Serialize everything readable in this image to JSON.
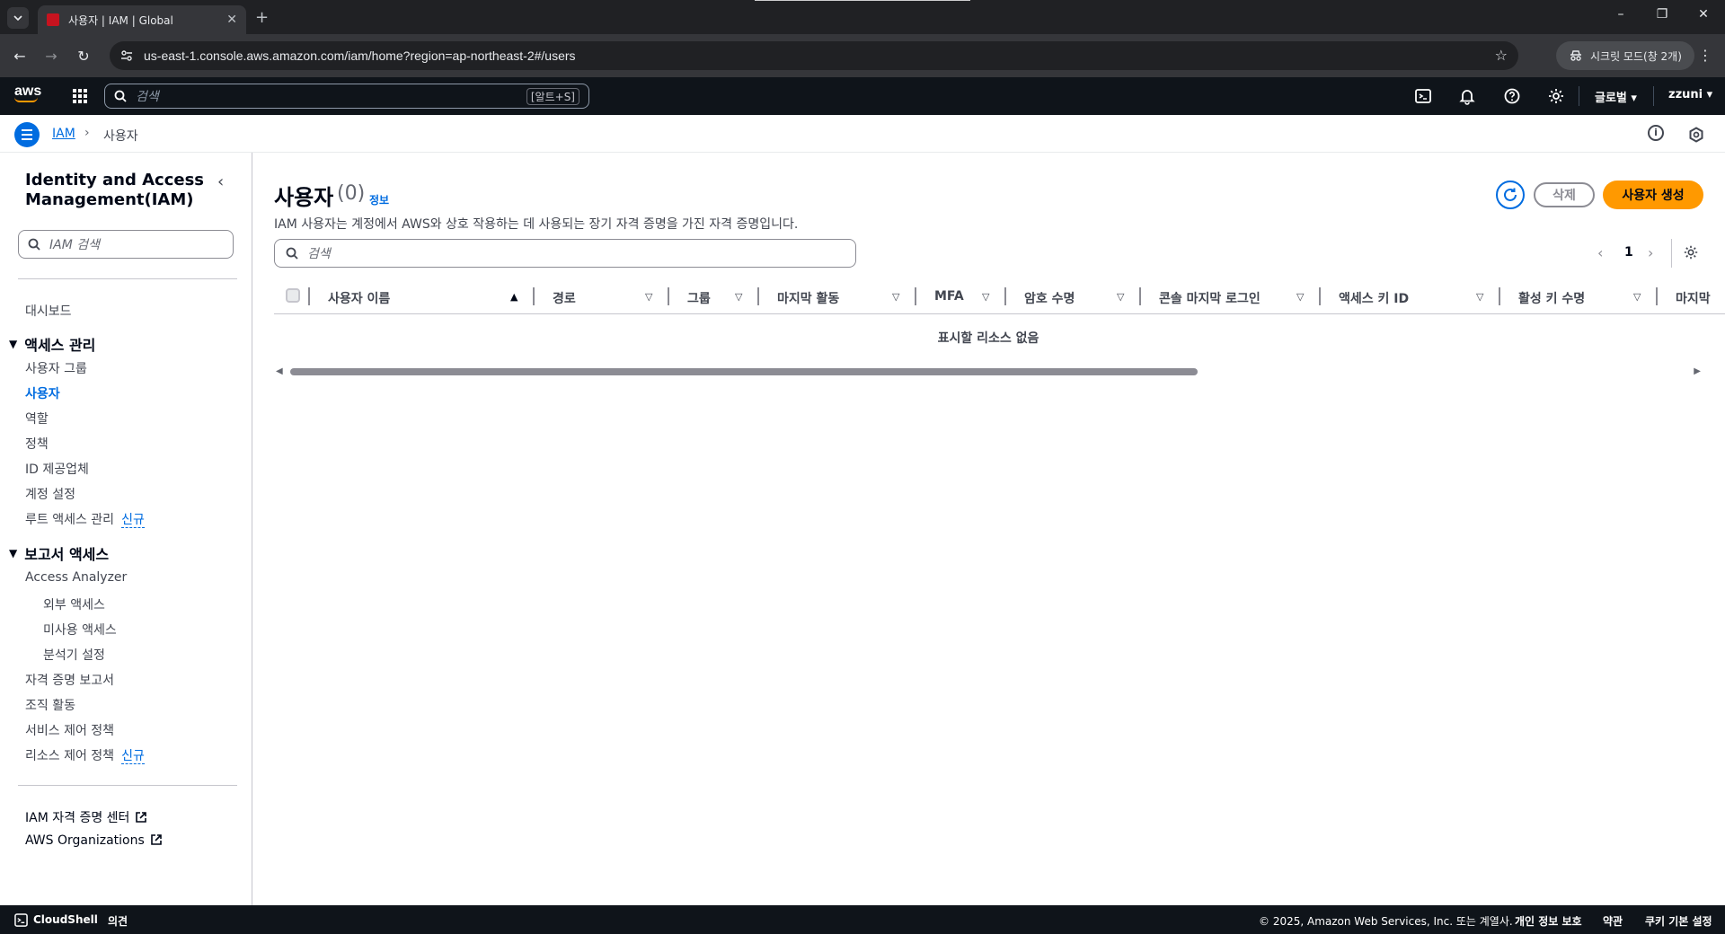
{
  "browser": {
    "tab_title": "사용자 | IAM | Global",
    "url": "us-east-1.console.aws.amazon.com/iam/home?region=ap-northeast-2#/users",
    "incognito_label": "시크릿 모드(창 2개)"
  },
  "aws_nav": {
    "logo": "aws",
    "search_placeholder": "검색",
    "search_shortcut": "[알트+S]",
    "region": "글로벌 ▾",
    "account": "zzuni ▾"
  },
  "breadcrumb": {
    "service": "IAM",
    "current": "사용자"
  },
  "sidebar": {
    "title": "Identity and Access Management(IAM)",
    "search_placeholder": "IAM 검색",
    "dashboard": "대시보드",
    "section_access": "액세스 관리",
    "access_items": [
      "사용자 그룹",
      "사용자",
      "역할",
      "정책",
      "ID 제공업체",
      "계정 설정",
      "루트 액세스 관리"
    ],
    "new_badge": "신규",
    "section_reports": "보고서 액세스",
    "access_analyzer": "Access Analyzer",
    "analyzer_items": [
      "외부 액세스",
      "미사용 액세스",
      "분석기 설정"
    ],
    "report_items": [
      "자격 증명 보고서",
      "조직 활동",
      "서비스 제어 정책",
      "리소스 제어 정책"
    ],
    "links": [
      "IAM 자격 증명 센터",
      "AWS Organizations"
    ]
  },
  "main": {
    "title": "사용자",
    "count": "(0)",
    "info": "정보",
    "description": "IAM 사용자는 계정에서 AWS와 상호 작용하는 데 사용되는 장기 자격 증명을 가진 자격 증명입니다.",
    "delete_label": "삭제",
    "create_label": "사용자 생성",
    "search_placeholder": "검색",
    "page_number": "1",
    "columns": [
      "사용자 이름",
      "경로",
      "그룹",
      "마지막 활동",
      "MFA",
      "암호 수명",
      "콘솔 마지막 로그인",
      "액세스 키 ID",
      "활성 키 수명",
      "마지막"
    ],
    "empty_text": "표시할 리소스 없음"
  },
  "footer": {
    "cloudshell": "CloudShell",
    "feedback": "의견",
    "copyright": "© 2025, Amazon Web Services, Inc. 또는 계열사.",
    "privacy": "개인 정보 보호",
    "terms": "약관",
    "cookies": "쿠키 기본 설정"
  },
  "colors": {
    "accent": "#006ce0",
    "primary_button": "#ff9900",
    "nav_bg": "#0f141a"
  }
}
